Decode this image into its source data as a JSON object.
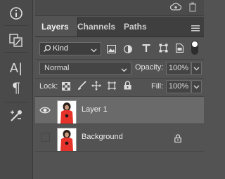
{
  "toolstrip": {
    "icons": [
      "info-icon",
      "tool-presets-icon",
      "character-icon",
      "paragraph-icon",
      "brush-settings-icon"
    ],
    "char_glyph": "A|",
    "para_glyph": "¶"
  },
  "topbar": {
    "icons": [
      "sync-cloud-icon",
      "trash-icon"
    ]
  },
  "tabs": [
    {
      "label": "Layers",
      "active": true
    },
    {
      "label": "Channels",
      "active": false
    },
    {
      "label": "Paths",
      "active": false
    }
  ],
  "filter": {
    "label": "Kind",
    "icons": [
      "pixel-filter-icon",
      "adjustment-filter-icon",
      "type-filter-icon",
      "shape-filter-icon",
      "smart-object-filter-icon"
    ]
  },
  "blend": {
    "mode": "Normal",
    "opacity_label": "Opacity:",
    "opacity_value": "100%"
  },
  "lock": {
    "label": "Lock:",
    "fill_label": "Fill:",
    "fill_value": "100%"
  },
  "layers": [
    {
      "name": "Layer 1",
      "visible": true,
      "selected": true,
      "locked": false
    },
    {
      "name": "Background",
      "visible": false,
      "selected": false,
      "locked": true
    }
  ],
  "colors": {
    "panel_bg": "#535353",
    "selected_row": "#6a6a6a",
    "thumb_shirt": "#e5322b"
  }
}
